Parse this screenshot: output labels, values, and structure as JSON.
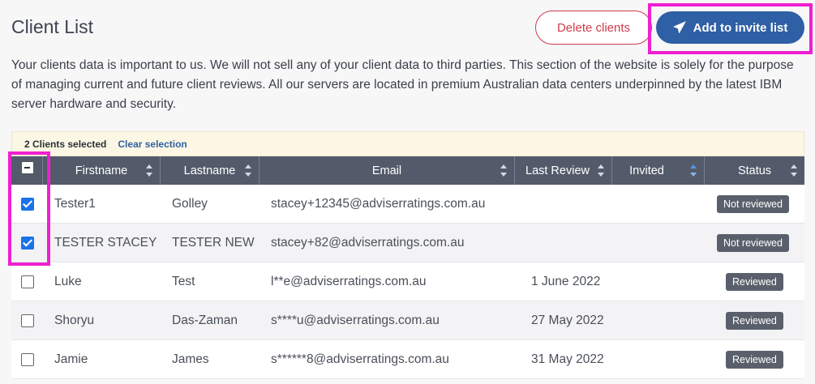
{
  "header": {
    "title": "Client List",
    "delete_label": "Delete clients",
    "add_label": "Add to invite list"
  },
  "intro": "Your clients data is important to us. We will not sell any of your client data to third parties. This section of the website is solely for the purpose of managing current and future client reviews. All our servers are located in premium Australian data centers underpinned by the latest IBM server hardware and security.",
  "selection": {
    "count_text": "2 Clients selected",
    "clear_label": "Clear selection"
  },
  "table": {
    "columns": [
      "Firstname",
      "Lastname",
      "Email",
      "Last Review",
      "Invited",
      "Status"
    ],
    "rows": [
      {
        "first": "Tester1",
        "last": "Golley",
        "email": "stacey+12345@adviserratings.com.au",
        "review": "",
        "status": "Not reviewed",
        "checked": true
      },
      {
        "first": "TESTER STACEY",
        "last": "TESTER NEW",
        "email": "stacey+82@adviserratings.com.au",
        "review": "",
        "status": "Not reviewed",
        "checked": true
      },
      {
        "first": "Luke",
        "last": "Test",
        "email": "l**e@adviserratings.com.au",
        "review": "1 June 2022",
        "status": "Reviewed",
        "checked": false
      },
      {
        "first": "Shoryu",
        "last": "Das-Zaman",
        "email": "s****u@adviserratings.com.au",
        "review": "27 May 2022",
        "status": "Reviewed",
        "checked": false
      },
      {
        "first": "Jamie",
        "last": "James",
        "email": "s******8@adviserratings.com.au",
        "review": "31 May 2022",
        "status": "Reviewed",
        "checked": false
      }
    ]
  },
  "colors": {
    "accent": "#2f5fa4",
    "danger": "#cf3a4a",
    "highlight": "#f01fd0",
    "header_bg": "#535b6a"
  },
  "icons": {
    "add_button": "paper-plane-icon"
  }
}
